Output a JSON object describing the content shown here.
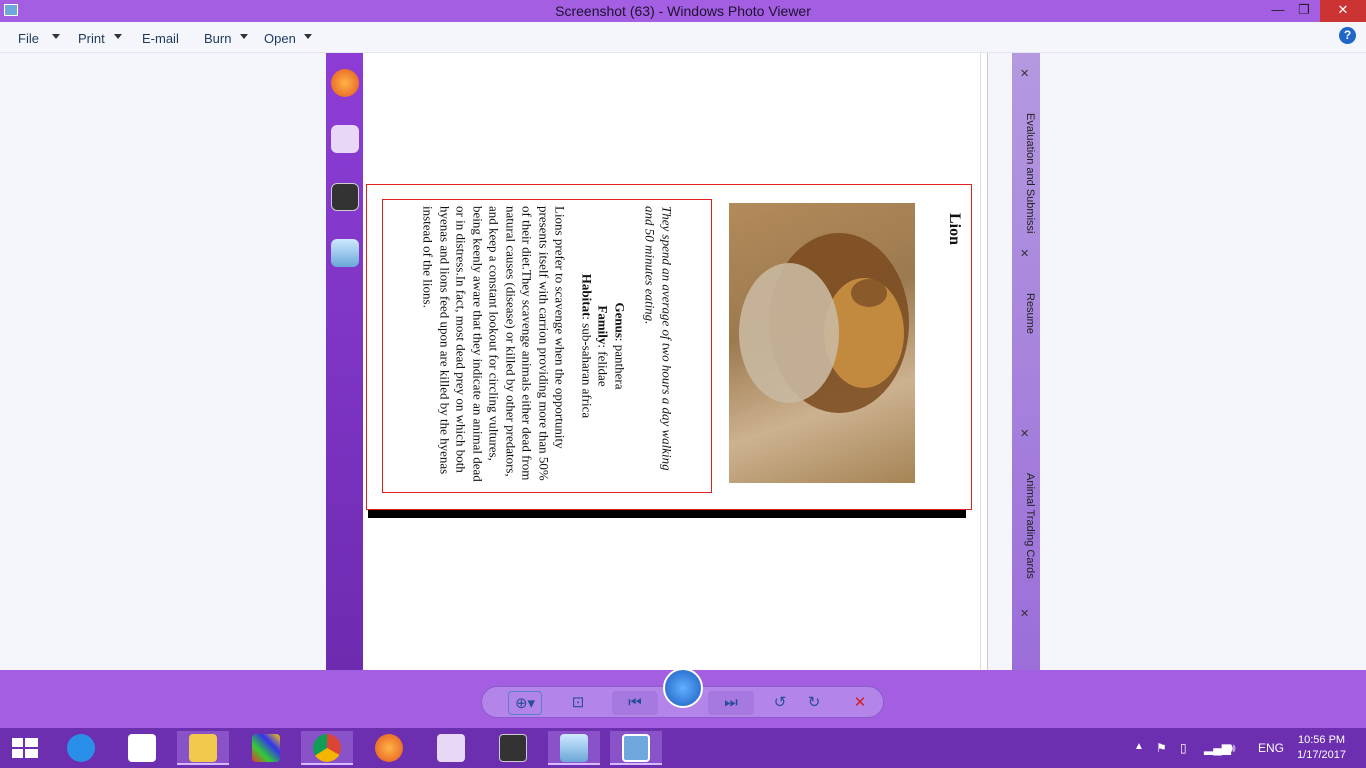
{
  "window": {
    "title": "Screenshot (63) - Windows Photo Viewer"
  },
  "menu": {
    "file": "File",
    "print": "Print",
    "email": "E-mail",
    "burn": "Burn",
    "open": "Open"
  },
  "card": {
    "name": "Lion",
    "fact": "They spend an average of two hours a day walking and 50 minutes eating.",
    "genus_label": "Genus",
    "genus": ": panthera",
    "family_label": "Family",
    "family": ": felidae",
    "habitat_label": "Habitat",
    "habitat": ": sub-saharan africa",
    "description": "Lions prefer to scavenge when the opportunity presents itself with carrion providing more than 50% of their diet.They scavenge animals either dead from natural causes (disease) or killed by other predators, and keep a constant lookout for circling vultures, being keenly aware that they indicate an animal dead or in distress.In fact, most dead prey on which both hyenas and lions feed upon are killed by the hyenas instead of the lions."
  },
  "side_tabs": {
    "tab1": "Evaluation and Submissi",
    "tab2": "Resume",
    "tab3": "Animal Trading Cards"
  },
  "tray": {
    "lang": "ENG",
    "time": "10:56 PM",
    "date": "1/17/2017"
  }
}
